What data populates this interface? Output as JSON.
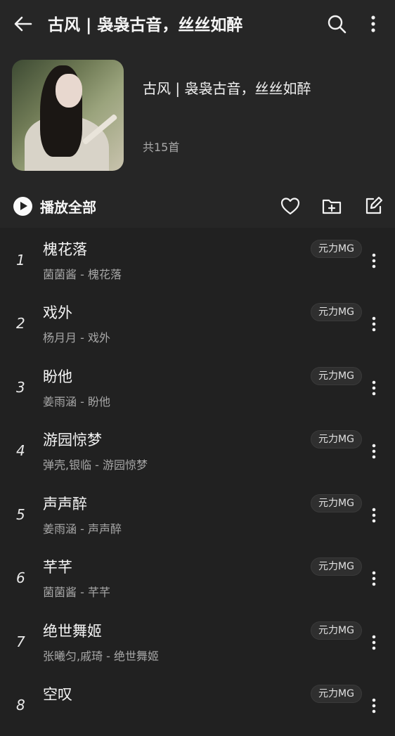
{
  "topbar": {
    "title": "古风 | 袅袅古音，丝丝如醉",
    "back_icon": "arrow-left-icon",
    "search_icon": "search-icon",
    "more_icon": "more-vertical-icon"
  },
  "playlist": {
    "title": "古风 | 袅袅古音，丝丝如醉",
    "count_text": "共15首"
  },
  "actions": {
    "play_all_label": "播放全部",
    "favorite_icon": "heart-icon",
    "add_folder_icon": "folder-add-icon",
    "edit_icon": "edit-icon"
  },
  "songs": [
    {
      "index": "1",
      "title": "槐花落",
      "artist": "菌菌酱 - 槐花落",
      "tag": "元力MG"
    },
    {
      "index": "2",
      "title": "戏外",
      "artist": "杨月月 - 戏外",
      "tag": "元力MG"
    },
    {
      "index": "3",
      "title": "盼他",
      "artist": "姜雨涵 - 盼他",
      "tag": "元力MG"
    },
    {
      "index": "4",
      "title": "游园惊梦",
      "artist": "弹壳,银临 - 游园惊梦",
      "tag": "元力MG"
    },
    {
      "index": "5",
      "title": "声声醉",
      "artist": "姜雨涵 - 声声醉",
      "tag": "元力MG"
    },
    {
      "index": "6",
      "title": "芊芊",
      "artist": "菌菌酱 - 芊芊",
      "tag": "元力MG"
    },
    {
      "index": "7",
      "title": "绝世舞姬",
      "artist": "张曦匀,戚琦 - 绝世舞姬",
      "tag": "元力MG"
    },
    {
      "index": "8",
      "title": "空叹",
      "artist": "",
      "tag": "元力MG"
    }
  ]
}
